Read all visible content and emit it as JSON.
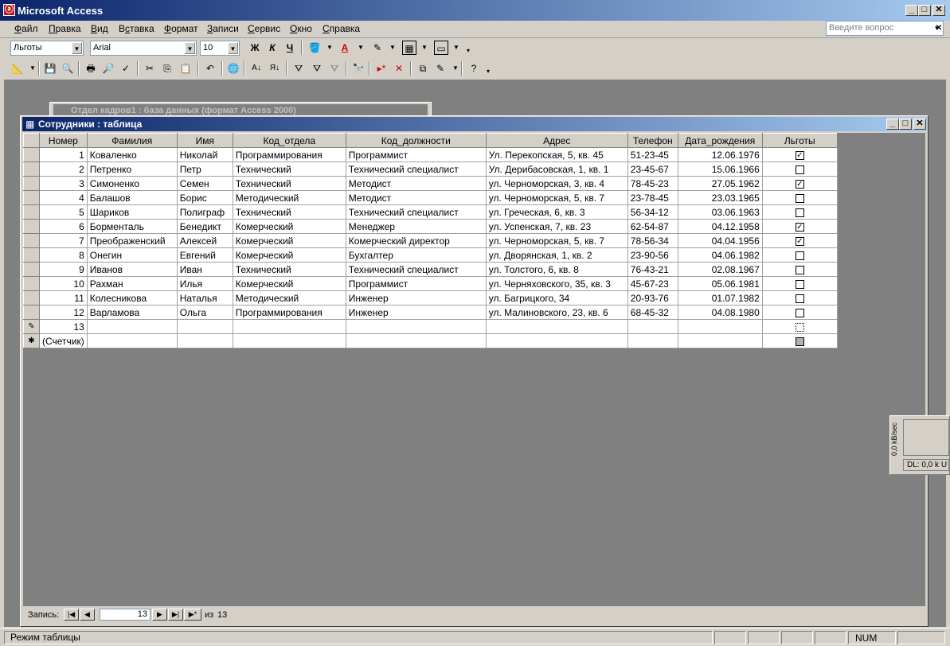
{
  "app": {
    "title": "Microsoft Access"
  },
  "menu": [
    "Файл",
    "Правка",
    "Вид",
    "Вставка",
    "Формат",
    "Записи",
    "Сервис",
    "Окно",
    "Справка"
  ],
  "menu_underline": [
    "Ф",
    "П",
    "В",
    "с",
    "Ф",
    "З",
    "С",
    "О",
    "С"
  ],
  "ask_placeholder": "Введите вопрос",
  "format_toolbar": {
    "object": "Льготы",
    "font": "Arial",
    "size": "10",
    "bold": "Ж",
    "italic": "К",
    "underline": "Ч"
  },
  "background_window": {
    "title": "Отдел кадров1 : база данных (формат Access 2000)"
  },
  "table_window": {
    "title": "Сотрудники : таблица",
    "columns": [
      "Номер",
      "Фамилия",
      "Имя",
      "Код_отдела",
      "Код_должности",
      "Адрес",
      "Телефон",
      "Дата_рождения",
      "Льготы"
    ],
    "rows": [
      [
        "1",
        "Коваленко",
        "Николай",
        "Программирования",
        "Программист",
        "Ул. Перекопская, 5, кв. 45",
        "51-23-45",
        "12.06.1976",
        true
      ],
      [
        "2",
        "Петренко",
        "Петр",
        "Технический",
        "Технический специалист",
        "Ул. Дерибасовская, 1, кв. 1",
        "23-45-67",
        "15.06.1966",
        false
      ],
      [
        "3",
        "Симоненко",
        "Семен",
        "Технический",
        "Методист",
        "ул. Черноморская, 3, кв. 4",
        "78-45-23",
        "27.05.1962",
        true
      ],
      [
        "4",
        "Балашов",
        "Борис",
        "Методический",
        "Методист",
        "ул. Черноморская, 5, кв. 7",
        "23-78-45",
        "23.03.1965",
        false
      ],
      [
        "5",
        "Шариков",
        "Полиграф",
        "Технический",
        "Технический специалист",
        "ул. Греческая, 6, кв. 3",
        "56-34-12",
        "03.06.1963",
        false
      ],
      [
        "6",
        "Борменталь",
        "Бенедикт",
        "Комерческий",
        "Менеджер",
        "ул. Успенская, 7, кв. 23",
        "62-54-87",
        "04.12.1958",
        true
      ],
      [
        "7",
        "Преображенский",
        "Алексей",
        "Комерческий",
        "Комерческий директор",
        "ул. Черноморская, 5, кв. 7",
        "78-56-34",
        "04.04.1956",
        true
      ],
      [
        "8",
        "Онегин",
        "Евгений",
        "Комерческий",
        "Бухгалтер",
        "ул. Дворянская, 1, кв. 2",
        "23-90-56",
        "04.06.1982",
        false
      ],
      [
        "9",
        "Иванов",
        "Иван",
        "Технический",
        "Технический специалист",
        "ул. Толстого, 6, кв. 8",
        "76-43-21",
        "02.08.1967",
        false
      ],
      [
        "10",
        "Рахман",
        "Илья",
        "Комерческий",
        "Программист",
        "ул. Черняховского, 35, кв. 3",
        "45-67-23",
        "05.06.1981",
        false
      ],
      [
        "11",
        "Колесникова",
        "Наталья",
        "Методический",
        "Инженер",
        "ул. Багрицкого, 34",
        "20-93-76",
        "01.07.1982",
        false
      ],
      [
        "12",
        "Варламова",
        "Ольга",
        "Программирования",
        "Инженер",
        "ул. Малиновского, 23, кв. 6",
        "68-45-32",
        "04.08.1980",
        false
      ]
    ],
    "editing_row_number": "13",
    "new_row_placeholder": "(Счетчик)"
  },
  "navigation": {
    "label": "Запись:",
    "current": "13",
    "of_label": "из",
    "total": "13"
  },
  "status": {
    "mode": "Режим таблицы",
    "num": "NUM"
  },
  "meter": {
    "axis_label": "0,0 kB/sec",
    "dl_label": "DL: 0,0 k",
    "ul_label": "U"
  }
}
